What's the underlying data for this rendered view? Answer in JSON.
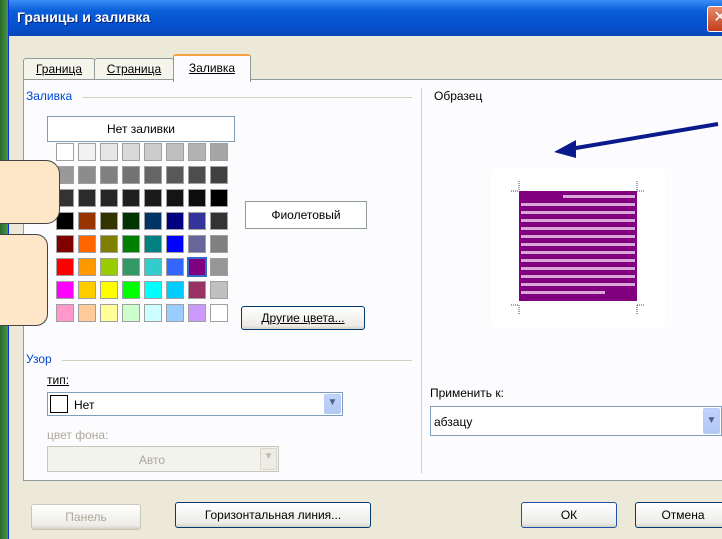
{
  "window": {
    "title": "Границы и заливка",
    "close_glyph": "✕"
  },
  "tabs": [
    {
      "label": "Граница",
      "active": false
    },
    {
      "label": "Страница",
      "active": false
    },
    {
      "label": "Заливка",
      "active": true
    }
  ],
  "fill": {
    "group_label": "Заливка",
    "no_fill_label": "Нет заливки",
    "selected_color_name": "Фиолетовый",
    "more_colors_label": "Другие цвета...",
    "selected_color_hex": "#800080"
  },
  "palette": [
    [
      "#ffffff",
      "#f2f2f2",
      "#e6e6e6",
      "#d9d9d9",
      "#cccccc",
      "#bfbfbf",
      "#b3b3b3",
      "#a6a6a6"
    ],
    [
      "#999999",
      "#8c8c8c",
      "#808080",
      "#737373",
      "#666666",
      "#595959",
      "#4d4d4d",
      "#404040"
    ],
    [
      "#333333",
      "#2b2b2b",
      "#262626",
      "#1f1f1f",
      "#1a1a1a",
      "#141414",
      "#0d0d0d",
      "#000000"
    ],
    [
      "#000000",
      "#993300",
      "#333300",
      "#003300",
      "#003366",
      "#000080",
      "#333399",
      "#333333"
    ],
    [
      "#800000",
      "#ff6600",
      "#808000",
      "#008000",
      "#008080",
      "#0000ff",
      "#666699",
      "#808080"
    ],
    [
      "#ff0000",
      "#ff9900",
      "#99cc00",
      "#339966",
      "#33cccc",
      "#3366ff",
      "#800080",
      "#969696"
    ],
    [
      "#ff00ff",
      "#ffcc00",
      "#ffff00",
      "#00ff00",
      "#00ffff",
      "#00ccff",
      "#993366",
      "#c0c0c0"
    ],
    [
      "#ff99cc",
      "#ffcc99",
      "#ffff99",
      "#ccffcc",
      "#ccffff",
      "#99ccff",
      "#cc99ff",
      "#ffffff"
    ]
  ],
  "pattern": {
    "group_label": "Узор",
    "type_label": "тип:",
    "type_value": "Нет",
    "bg_color_label": "цвет фона:",
    "bg_color_value": "Авто"
  },
  "sample": {
    "group_label": "Образец",
    "apply_label": "Применить к:",
    "apply_value": "абзацу"
  },
  "footer": {
    "panel_label": "Панель",
    "hline_label": "Горизонтальная линия...",
    "ok_label": "ОК",
    "cancel_label": "Отмена"
  }
}
